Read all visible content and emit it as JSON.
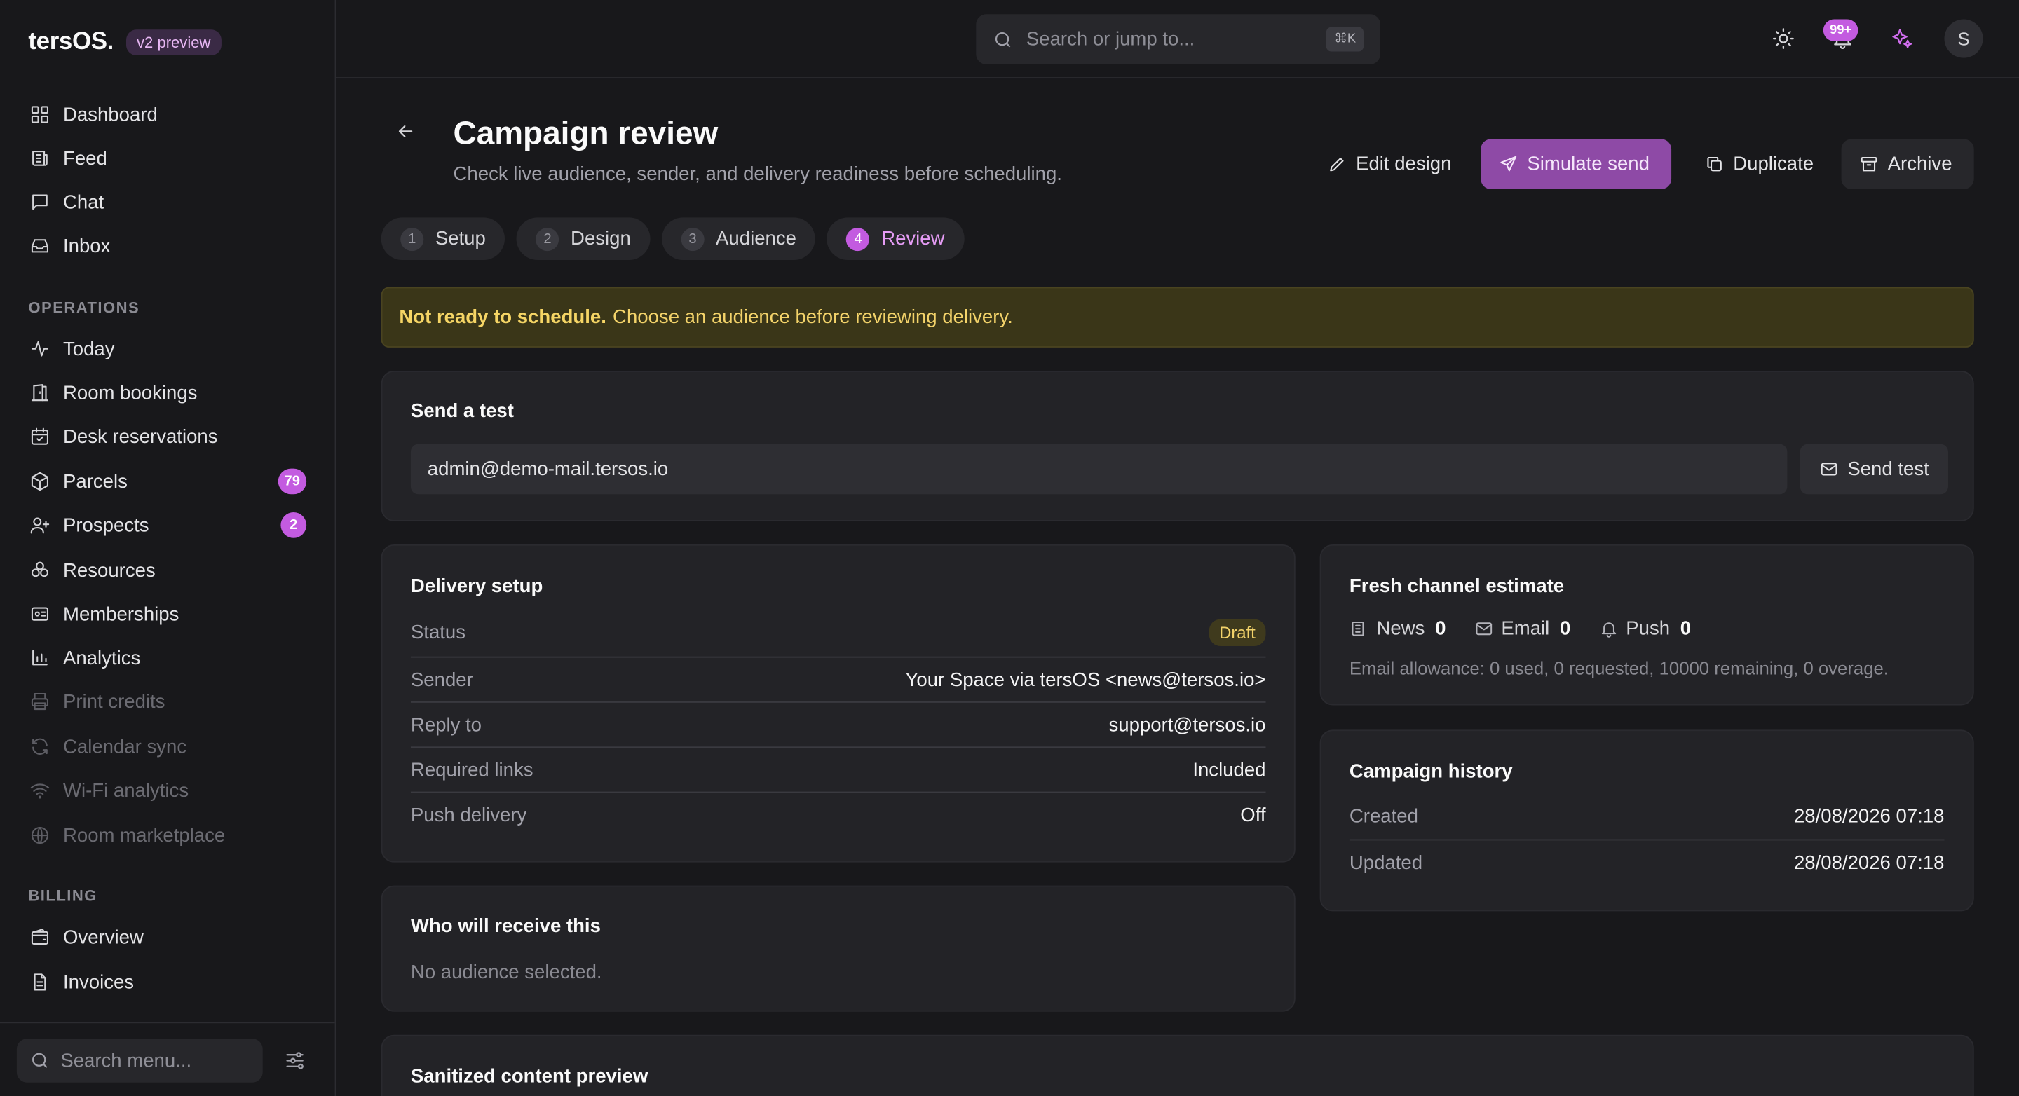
{
  "brand": {
    "name": "tersOS.",
    "badge": "v2 preview"
  },
  "sidebar": {
    "main": [
      {
        "label": "Dashboard"
      },
      {
        "label": "Feed"
      },
      {
        "label": "Chat"
      },
      {
        "label": "Inbox"
      }
    ],
    "operations_label": "OPERATIONS",
    "operations": [
      {
        "label": "Today"
      },
      {
        "label": "Room bookings"
      },
      {
        "label": "Desk reservations"
      },
      {
        "label": "Parcels",
        "count": "79"
      },
      {
        "label": "Prospects",
        "count": "2"
      },
      {
        "label": "Resources"
      },
      {
        "label": "Memberships"
      },
      {
        "label": "Analytics"
      },
      {
        "label": "Print credits"
      },
      {
        "label": "Calendar sync"
      },
      {
        "label": "Wi-Fi analytics"
      },
      {
        "label": "Room marketplace"
      }
    ],
    "billing_label": "BILLING",
    "billing": [
      {
        "label": "Overview"
      },
      {
        "label": "Invoices"
      }
    ],
    "search_placeholder": "Search menu..."
  },
  "topbar": {
    "search_placeholder": "Search or jump to...",
    "shortcut": "⌘K",
    "notifications": "99+",
    "avatar": "S"
  },
  "page": {
    "title": "Campaign review",
    "subtitle": "Check live audience, sender, and delivery readiness before scheduling.",
    "actions": {
      "edit": "Edit design",
      "simulate": "Simulate send",
      "duplicate": "Duplicate",
      "archive": "Archive"
    },
    "tabs": [
      {
        "num": "1",
        "label": "Setup"
      },
      {
        "num": "2",
        "label": "Design"
      },
      {
        "num": "3",
        "label": "Audience"
      },
      {
        "num": "4",
        "label": "Review"
      }
    ],
    "alert": {
      "strong": "Not ready to schedule.",
      "text": "Choose an audience before reviewing delivery."
    }
  },
  "send_test": {
    "title": "Send a test",
    "email": "admin@demo-mail.tersos.io",
    "button": "Send test"
  },
  "delivery": {
    "title": "Delivery setup",
    "status_label": "Status",
    "status_value": "Draft",
    "rows": [
      {
        "k": "Sender",
        "v": "Your Space via tersOS <news@tersos.io>"
      },
      {
        "k": "Reply to",
        "v": "support@tersos.io"
      },
      {
        "k": "Required links",
        "v": "Included"
      },
      {
        "k": "Push delivery",
        "v": "Off"
      }
    ]
  },
  "audience": {
    "title": "Who will receive this",
    "empty": "No audience selected."
  },
  "estimate": {
    "title": "Fresh channel estimate",
    "channels": [
      {
        "label": "News",
        "value": "0"
      },
      {
        "label": "Email",
        "value": "0"
      },
      {
        "label": "Push",
        "value": "0"
      }
    ],
    "allowance": "Email allowance: 0 used, 0 requested, 10000 remaining, 0 overage."
  },
  "history": {
    "title": "Campaign history",
    "rows": [
      {
        "k": "Created",
        "v": "28/08/2026 07:18"
      },
      {
        "k": "Updated",
        "v": "28/08/2026 07:18"
      }
    ]
  },
  "preview": {
    "title": "Sanitized content preview"
  },
  "colors": {
    "accent": "#c35be0",
    "primary_button": "#8e4aa6",
    "warning_bg": "#3a3618",
    "warning_text": "#f3d36a"
  }
}
